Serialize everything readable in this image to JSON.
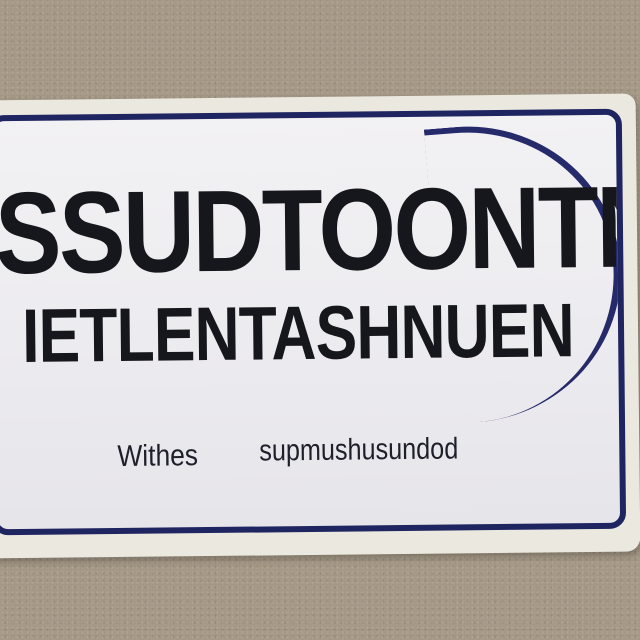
{
  "sign": {
    "headline": "SSUDTOONTN",
    "subheadline": "IETLENTASHNUEN",
    "footer_left": "Withes",
    "footer_right": "supmushusundod",
    "colors": {
      "wall": "#a99c89",
      "board": "#ebe8df",
      "face": "#efeef2",
      "border_navy": "#1f2561",
      "text": "#16171d"
    }
  }
}
